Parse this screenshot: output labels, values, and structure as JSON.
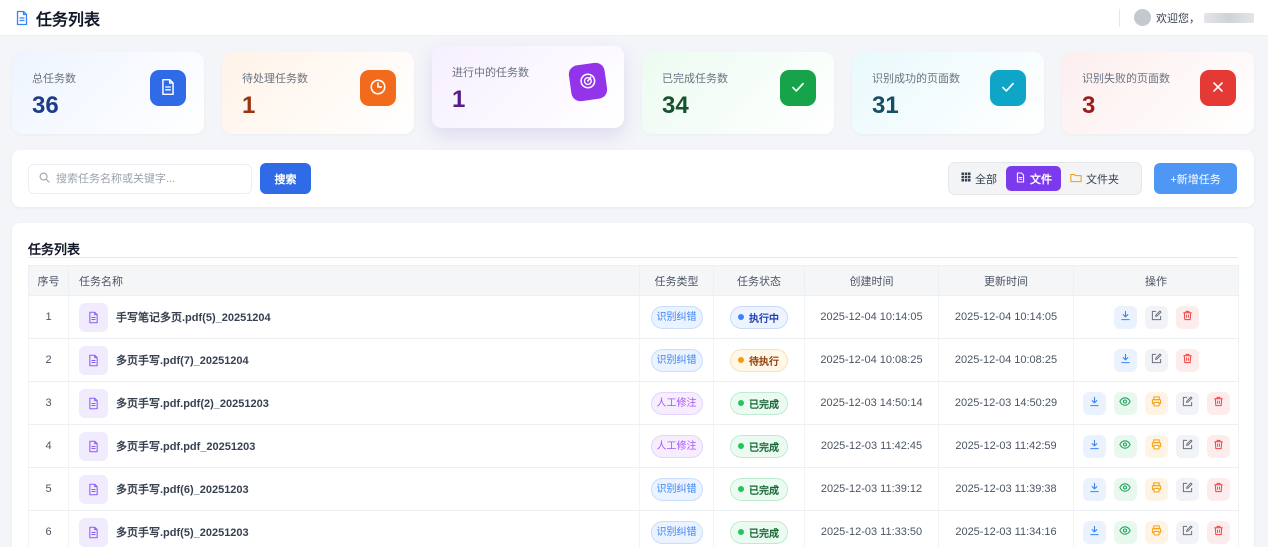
{
  "header": {
    "title": "任务列表",
    "welcome": "欢迎您，"
  },
  "stats": [
    {
      "label": "总任务数",
      "value": "36",
      "icon": "document-icon",
      "color": "#2f6be6",
      "bg": "#eef4ff",
      "value_color": "#1e3a8a"
    },
    {
      "label": "待处理任务数",
      "value": "1",
      "icon": "clock-icon",
      "color": "#f26b1d",
      "bg": "#fff3e8",
      "value_color": "#9a3412"
    },
    {
      "label": "进行中的任务数",
      "value": "1",
      "icon": "gauge-icon",
      "color": "#9333ea",
      "bg": "#f6f0ff",
      "value_color": "#581c87"
    },
    {
      "label": "已完成任务数",
      "value": "34",
      "icon": "check-icon",
      "color": "#16a34a",
      "bg": "#ecfbf1",
      "value_color": "#14532d"
    },
    {
      "label": "识别成功的页面数",
      "value": "31",
      "icon": "check-icon",
      "color": "#0ea5c6",
      "bg": "#e9f9fc",
      "value_color": "#164e63"
    },
    {
      "label": "识别失败的页面数",
      "value": "3",
      "icon": "close-icon",
      "color": "#e53935",
      "bg": "#fdeeee",
      "value_color": "#991b1b"
    }
  ],
  "toolbar": {
    "search_placeholder": "搜索任务名称或关键字...",
    "search_label": "搜索",
    "filter_all": "全部",
    "filter_file": "文件",
    "filter_folder": "文件夹",
    "add_label": "+新增任务"
  },
  "panel": {
    "title": "任务列表",
    "columns": [
      "序号",
      "任务名称",
      "任务类型",
      "任务状态",
      "创建时间",
      "更新时间",
      "操作"
    ]
  },
  "rows": [
    {
      "index": "1",
      "name": "手写笔记多页.pdf(5)_20251204",
      "type": "识别纠错",
      "type_style": "blue",
      "status": "执行中",
      "status_style": "running",
      "created": "2025-12-04 10:14:05",
      "updated": "2025-12-04 10:14:05",
      "actions": [
        "download",
        "edit",
        "delete"
      ]
    },
    {
      "index": "2",
      "name": "多页手写.pdf(7)_20251204",
      "type": "识别纠错",
      "type_style": "blue",
      "status": "待执行",
      "status_style": "pending",
      "created": "2025-12-04 10:08:25",
      "updated": "2025-12-04 10:08:25",
      "actions": [
        "download",
        "edit",
        "delete"
      ]
    },
    {
      "index": "3",
      "name": "多页手写.pdf.pdf(2)_20251203",
      "type": "人工修注",
      "type_style": "purple",
      "status": "已完成",
      "status_style": "done",
      "created": "2025-12-03 14:50:14",
      "updated": "2025-12-03 14:50:29",
      "actions": [
        "download",
        "view",
        "print",
        "edit",
        "delete"
      ]
    },
    {
      "index": "4",
      "name": "多页手写.pdf.pdf_20251203",
      "type": "人工修注",
      "type_style": "purple",
      "status": "已完成",
      "status_style": "done",
      "created": "2025-12-03 11:42:45",
      "updated": "2025-12-03 11:42:59",
      "actions": [
        "download",
        "view",
        "print",
        "edit",
        "delete"
      ]
    },
    {
      "index": "5",
      "name": "多页手写.pdf(6)_20251203",
      "type": "识别纠错",
      "type_style": "blue",
      "status": "已完成",
      "status_style": "done",
      "created": "2025-12-03 11:39:12",
      "updated": "2025-12-03 11:39:38",
      "actions": [
        "download",
        "view",
        "print",
        "edit",
        "delete"
      ]
    },
    {
      "index": "6",
      "name": "多页手写.pdf(5)_20251203",
      "type": "识别纠错",
      "type_style": "blue",
      "status": "已完成",
      "status_style": "done",
      "created": "2025-12-03 11:33:50",
      "updated": "2025-12-03 11:34:16",
      "actions": [
        "download",
        "view",
        "print",
        "edit",
        "delete"
      ]
    }
  ]
}
